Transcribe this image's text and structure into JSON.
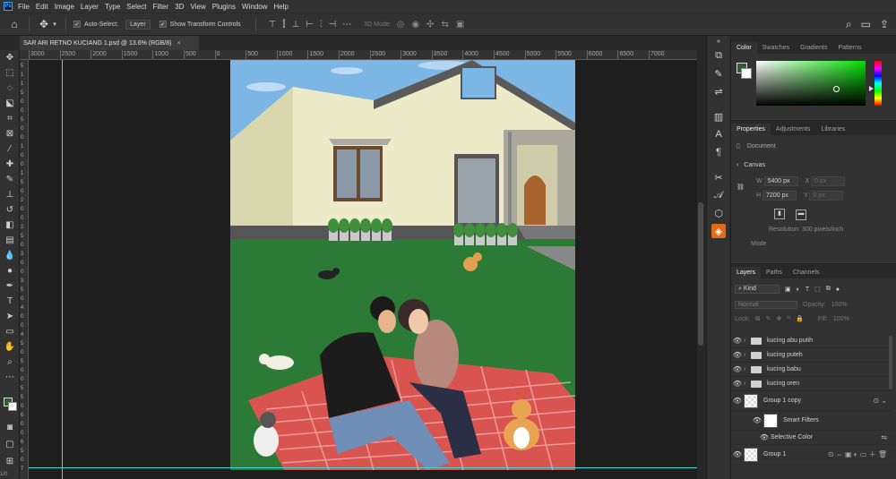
{
  "menubar": {
    "logo": "Ps",
    "items": [
      "File",
      "Edit",
      "Image",
      "Layer",
      "Type",
      "Select",
      "Filter",
      "3D",
      "View",
      "Plugins",
      "Window",
      "Help"
    ]
  },
  "options": {
    "auto_select_label": "Auto-Select:",
    "auto_select_value": "Layer",
    "transform_label": "Show Transform Controls",
    "mode_3d_label": "3D Mode:"
  },
  "document": {
    "tab_title": "SAR ARI RETNO KUCIANG 1.psd @ 13.6% (RGB/8)",
    "close_glyph": "×"
  },
  "ruler": {
    "top_ticks": [
      "3000",
      "2500",
      "2000",
      "1500",
      "1000",
      "500",
      "0",
      "500",
      "1000",
      "1500",
      "2000",
      "2500",
      "3000",
      "3500",
      "4000",
      "4500",
      "5000",
      "5500",
      "6000",
      "6500",
      "7000"
    ],
    "left_ticks": [
      "5",
      "1",
      "1",
      "5",
      "0",
      "0",
      "5",
      "0",
      "0",
      "1",
      "0",
      "0",
      "1",
      "5",
      "0",
      "2",
      "0",
      "0",
      "2",
      "5",
      "0",
      "3",
      "0",
      "0",
      "3",
      "5",
      "0",
      "4",
      "0",
      "0",
      "4",
      "5",
      "0",
      "5",
      "0",
      "0",
      "5",
      "5",
      "0",
      "6",
      "0",
      "0",
      "6",
      "5",
      "0",
      "7"
    ]
  },
  "color_panel": {
    "tabs": [
      "Color",
      "Swatches",
      "Gradients",
      "Patterns"
    ],
    "fg": "#2a5e2c",
    "bg": "#ffffff"
  },
  "properties_panel": {
    "tabs": [
      "Properties",
      "Adjustments",
      "Libraries"
    ],
    "document_label": "Document",
    "canvas_label": "Canvas",
    "w_label": "W",
    "w_value": "5400 px",
    "x_label": "X",
    "x_value": "0 px",
    "h_label": "H",
    "h_value": "7200 px",
    "y_label": "Y",
    "y_value": "0 px",
    "resolution": "Resolution: 300 pixels/inch",
    "mode_label": "Mode"
  },
  "layers_panel": {
    "tabs": [
      "Layers",
      "Paths",
      "Channels"
    ],
    "filter_kind": "Kind",
    "blend_mode": "Normal",
    "opacity_label": "Opacity:",
    "opacity_value": "100%",
    "lock_label": "Lock:",
    "fill_label": "Fill:",
    "fill_value": "100%",
    "layers": [
      {
        "name": "kucing abu putih",
        "kind": "folder"
      },
      {
        "name": "kucing puteh",
        "kind": "folder"
      },
      {
        "name": "kucing babu",
        "kind": "folder"
      },
      {
        "name": "kucing oren",
        "kind": "folder"
      },
      {
        "name": "Group 1 copy",
        "kind": "smart"
      },
      {
        "name": "Smart Filters",
        "kind": "filter"
      },
      {
        "name": "Selective Color",
        "kind": "effect"
      },
      {
        "name": "Group 1",
        "kind": "smart"
      }
    ]
  },
  "toolbar": {
    "fg": "#2a5e2c",
    "bg": "#ffffff"
  },
  "status": {
    "left_bottom": "1/0"
  }
}
